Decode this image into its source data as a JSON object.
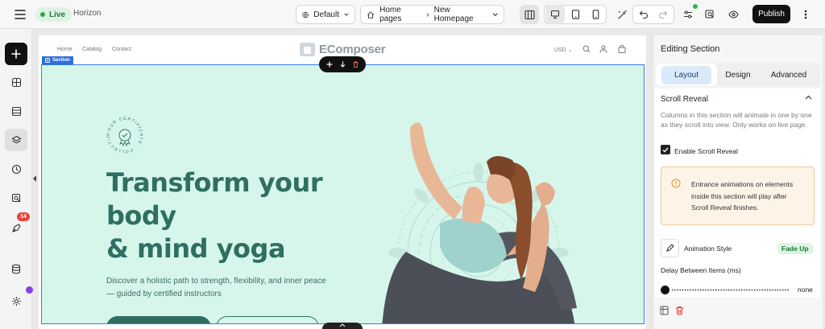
{
  "topbar": {
    "live_label": "Live",
    "site_name": "Horizon",
    "theme_select": "Default",
    "breadcrumb_root": "Home pages",
    "breadcrumb_current": "New Homepage",
    "publish_label": "Publish"
  },
  "rail": {
    "history_badge": "14"
  },
  "store": {
    "nav_links": [
      "Home",
      "Catalog",
      "Contact"
    ],
    "logo_text": "EComposer",
    "currency": "USD"
  },
  "canvas": {
    "section_label": "Section",
    "certificate_text": "YOUR CERTIFICATE · COLLECTION ·",
    "hero_title_line1": "Transform your",
    "hero_title_line2": "body",
    "hero_title_line3": "& mind yoga",
    "hero_subtitle_line1": "Discover a holistic path to strength, flexibility, and inner peace",
    "hero_subtitle_line2": "— guided by certified instructors"
  },
  "panel": {
    "title": "Editing Section",
    "tabs": [
      "Layout",
      "Design",
      "Advanced"
    ],
    "active_tab": "Layout",
    "scroll_reveal": {
      "title": "Scroll Reveal",
      "description": "Columns in this section will animate in one by one as they scroll into view. Only works on live page.",
      "checkbox_label": "Enable Scroll Reveal",
      "checkbox_checked": true,
      "warning": "Entrance animations on elements inside this section will play after Scroll Reveal finishes.",
      "animation_style_label": "Animation Style",
      "animation_style_value": "Fade Up",
      "delay_label": "Delay Between Items (ms)",
      "delay_value": "none"
    }
  },
  "colors": {
    "accent": "#2f6f62",
    "hero_bg": "#d6f6ec",
    "selection": "#3b78e7",
    "publish": "#111111"
  }
}
